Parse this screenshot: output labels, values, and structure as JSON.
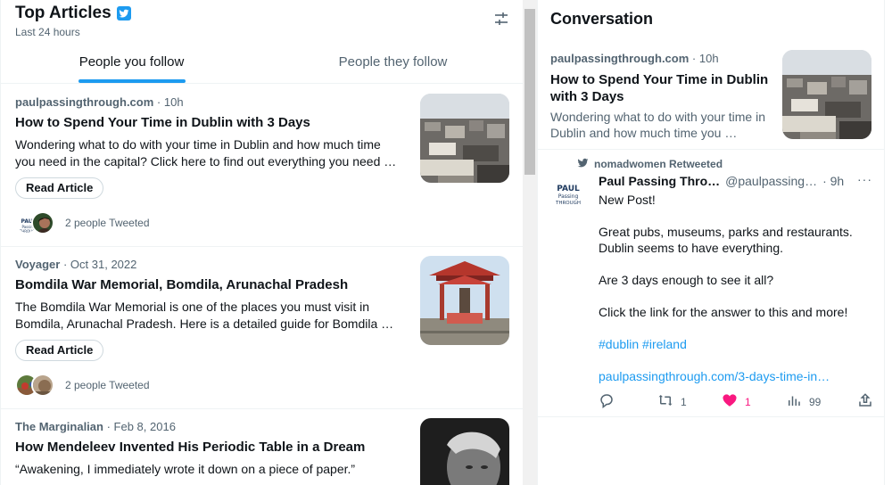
{
  "panel": {
    "title": "Top Articles",
    "subtitle": "Last 24 hours"
  },
  "tabs": [
    {
      "label": "People you follow",
      "active": true
    },
    {
      "label": "People they follow",
      "active": false
    }
  ],
  "articles": [
    {
      "source": "paulpassingthrough.com",
      "time": "10h",
      "title": "How to Spend Your Time in Dublin with 3 Days",
      "desc_line1": "Wondering what to do with your time in Dublin and how much time",
      "desc_line2": "you need in the capital? Click here to find out everything you need …",
      "button": "Read Article",
      "tweeted": "2 people Tweeted"
    },
    {
      "source": "Voyager",
      "time": "Oct 31, 2022",
      "title": "Bomdila War Memorial, Bomdila, Arunachal Pradesh",
      "desc_line1": "The Bomdila War Memorial is one of the places you must visit in",
      "desc_line2": "Bomdila, Arunachal Pradesh. Here is a detailed guide for Bomdila …",
      "button": "Read Article",
      "tweeted": "2 people Tweeted"
    },
    {
      "source": "The Marginalian",
      "time": "Feb 8, 2016",
      "title": "How Mendeleev Invented His Periodic Table in a Dream",
      "desc_line1": "“Awakening, I immediately wrote it down on a piece of paper.”",
      "desc_line2": ""
    }
  ],
  "conversation": {
    "title": "Conversation",
    "card": {
      "source": "paulpassingthrough.com",
      "time": "10h",
      "title": "How to Spend Your Time in Dublin with 3 Days",
      "desc": "Wondering what to do with your time in Dublin and how much time you …"
    },
    "tweet": {
      "retweeted_by": "nomadwomen Retweeted",
      "name": "Paul Passing Thro…",
      "handle": "@paulpassing…",
      "time": "· 9h",
      "more": "···",
      "lines": [
        "New Post!",
        "Great pubs, museums, parks and restaurants. Dublin seems to have everything.",
        "Are 3 days enough to see it all?",
        "Click the link for the answer to this and more!"
      ],
      "hashtags": "#dublin #ireland",
      "link": "paulpassingthrough.com/3-days-time-in…",
      "retweets": "1",
      "likes": "1",
      "views": "99"
    }
  },
  "avatar_text": {
    "line1": "PAUL",
    "line2": "Passing",
    "line3": "THROUGH"
  },
  "colors": {
    "accent": "#1d9bf0",
    "like": "#f91880",
    "muted": "#536471"
  }
}
